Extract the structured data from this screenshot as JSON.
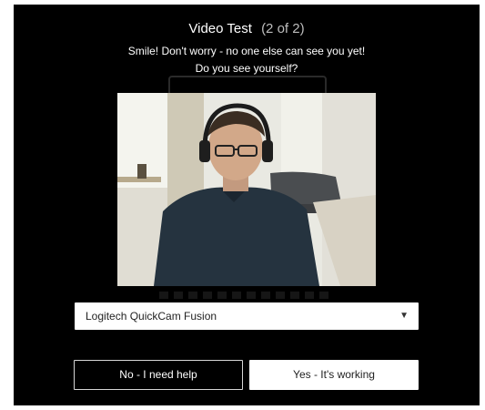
{
  "dialog": {
    "title": "Video Test",
    "step": "(2 of 2)",
    "line1": "Smile! Don't worry - no one else can see you yet!",
    "line2": "Do you see yourself?"
  },
  "camera_select": {
    "selected": "Logitech QuickCam Fusion",
    "caret_icon": "chevron-down-icon"
  },
  "buttons": {
    "no_label": "No - I need help",
    "yes_label": "Yes - It's working"
  },
  "colors": {
    "background": "#000000",
    "text": "#ffffff",
    "button_primary_bg": "#ffffff"
  }
}
